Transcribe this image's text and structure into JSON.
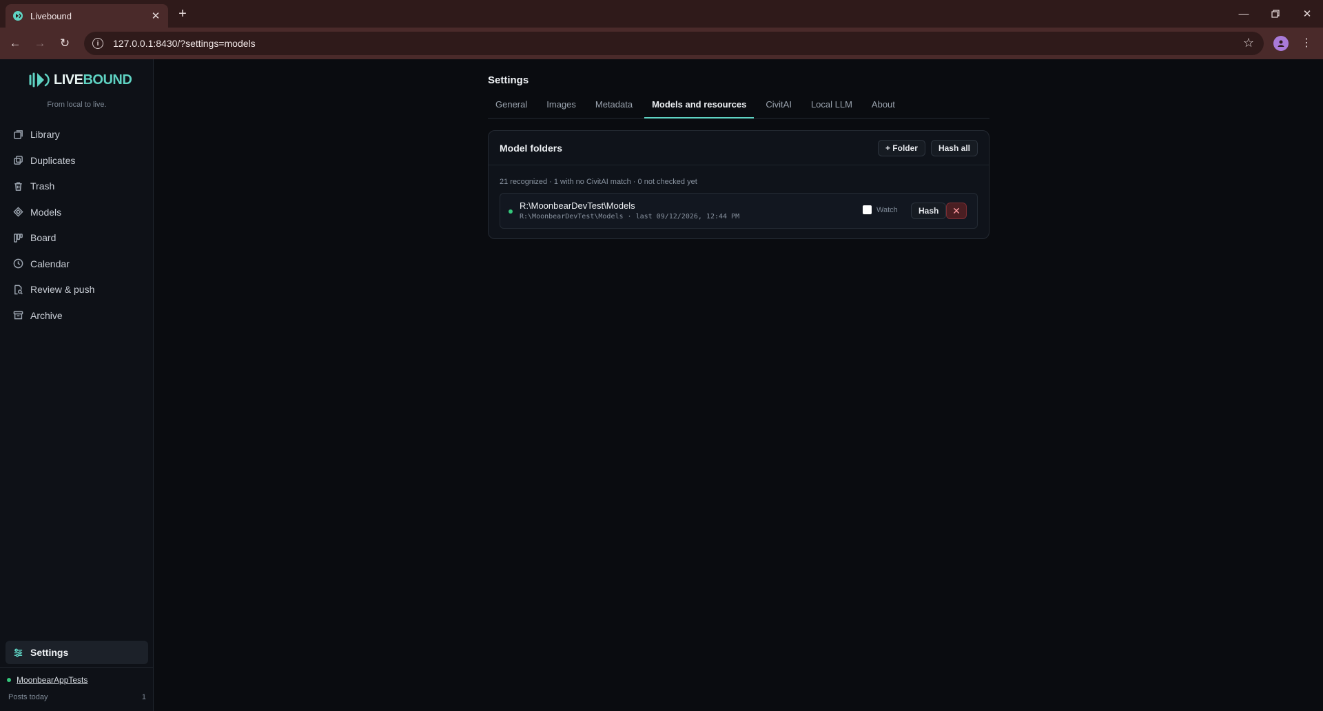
{
  "browser": {
    "tab_title": "Livebound",
    "url": "127.0.0.1:8430/?settings=models"
  },
  "sidebar": {
    "brand_a": "LIVE",
    "brand_b": "BOUND",
    "tagline": "From local to live.",
    "items": [
      {
        "label": "Library",
        "icon": "library-icon"
      },
      {
        "label": "Duplicates",
        "icon": "duplicates-icon"
      },
      {
        "label": "Trash",
        "icon": "trash-icon"
      },
      {
        "label": "Models",
        "icon": "models-icon"
      },
      {
        "label": "Board",
        "icon": "board-icon"
      },
      {
        "label": "Calendar",
        "icon": "calendar-icon"
      },
      {
        "label": "Review & push",
        "icon": "review-icon"
      },
      {
        "label": "Archive",
        "icon": "archive-icon"
      }
    ],
    "settings_label": "Settings",
    "account": "MoonbearAppTests",
    "posts_label": "Posts today",
    "posts_count": "1"
  },
  "settings": {
    "title": "Settings",
    "tabs": [
      "General",
      "Images",
      "Metadata",
      "Models and resources",
      "CivitAI",
      "Local LLM",
      "About"
    ],
    "active_tab": "Models and resources"
  },
  "model_folders": {
    "heading": "Model folders",
    "add_folder_label": "+ Folder",
    "hash_all_label": "Hash all",
    "stats": "21 recognized · 1 with no CivitAI match · 0 not checked yet",
    "folders": [
      {
        "name": "R:\\MoonbearDevTest\\Models",
        "detail": "R:\\MoonbearDevTest\\Models · last 09/12/2026, 12:44 PM",
        "watch_label": "Watch",
        "hash_label": "Hash"
      }
    ]
  },
  "colors": {
    "accent": "#5fd3c3",
    "status_ok": "#34c77b",
    "danger": "#7c2e34"
  }
}
